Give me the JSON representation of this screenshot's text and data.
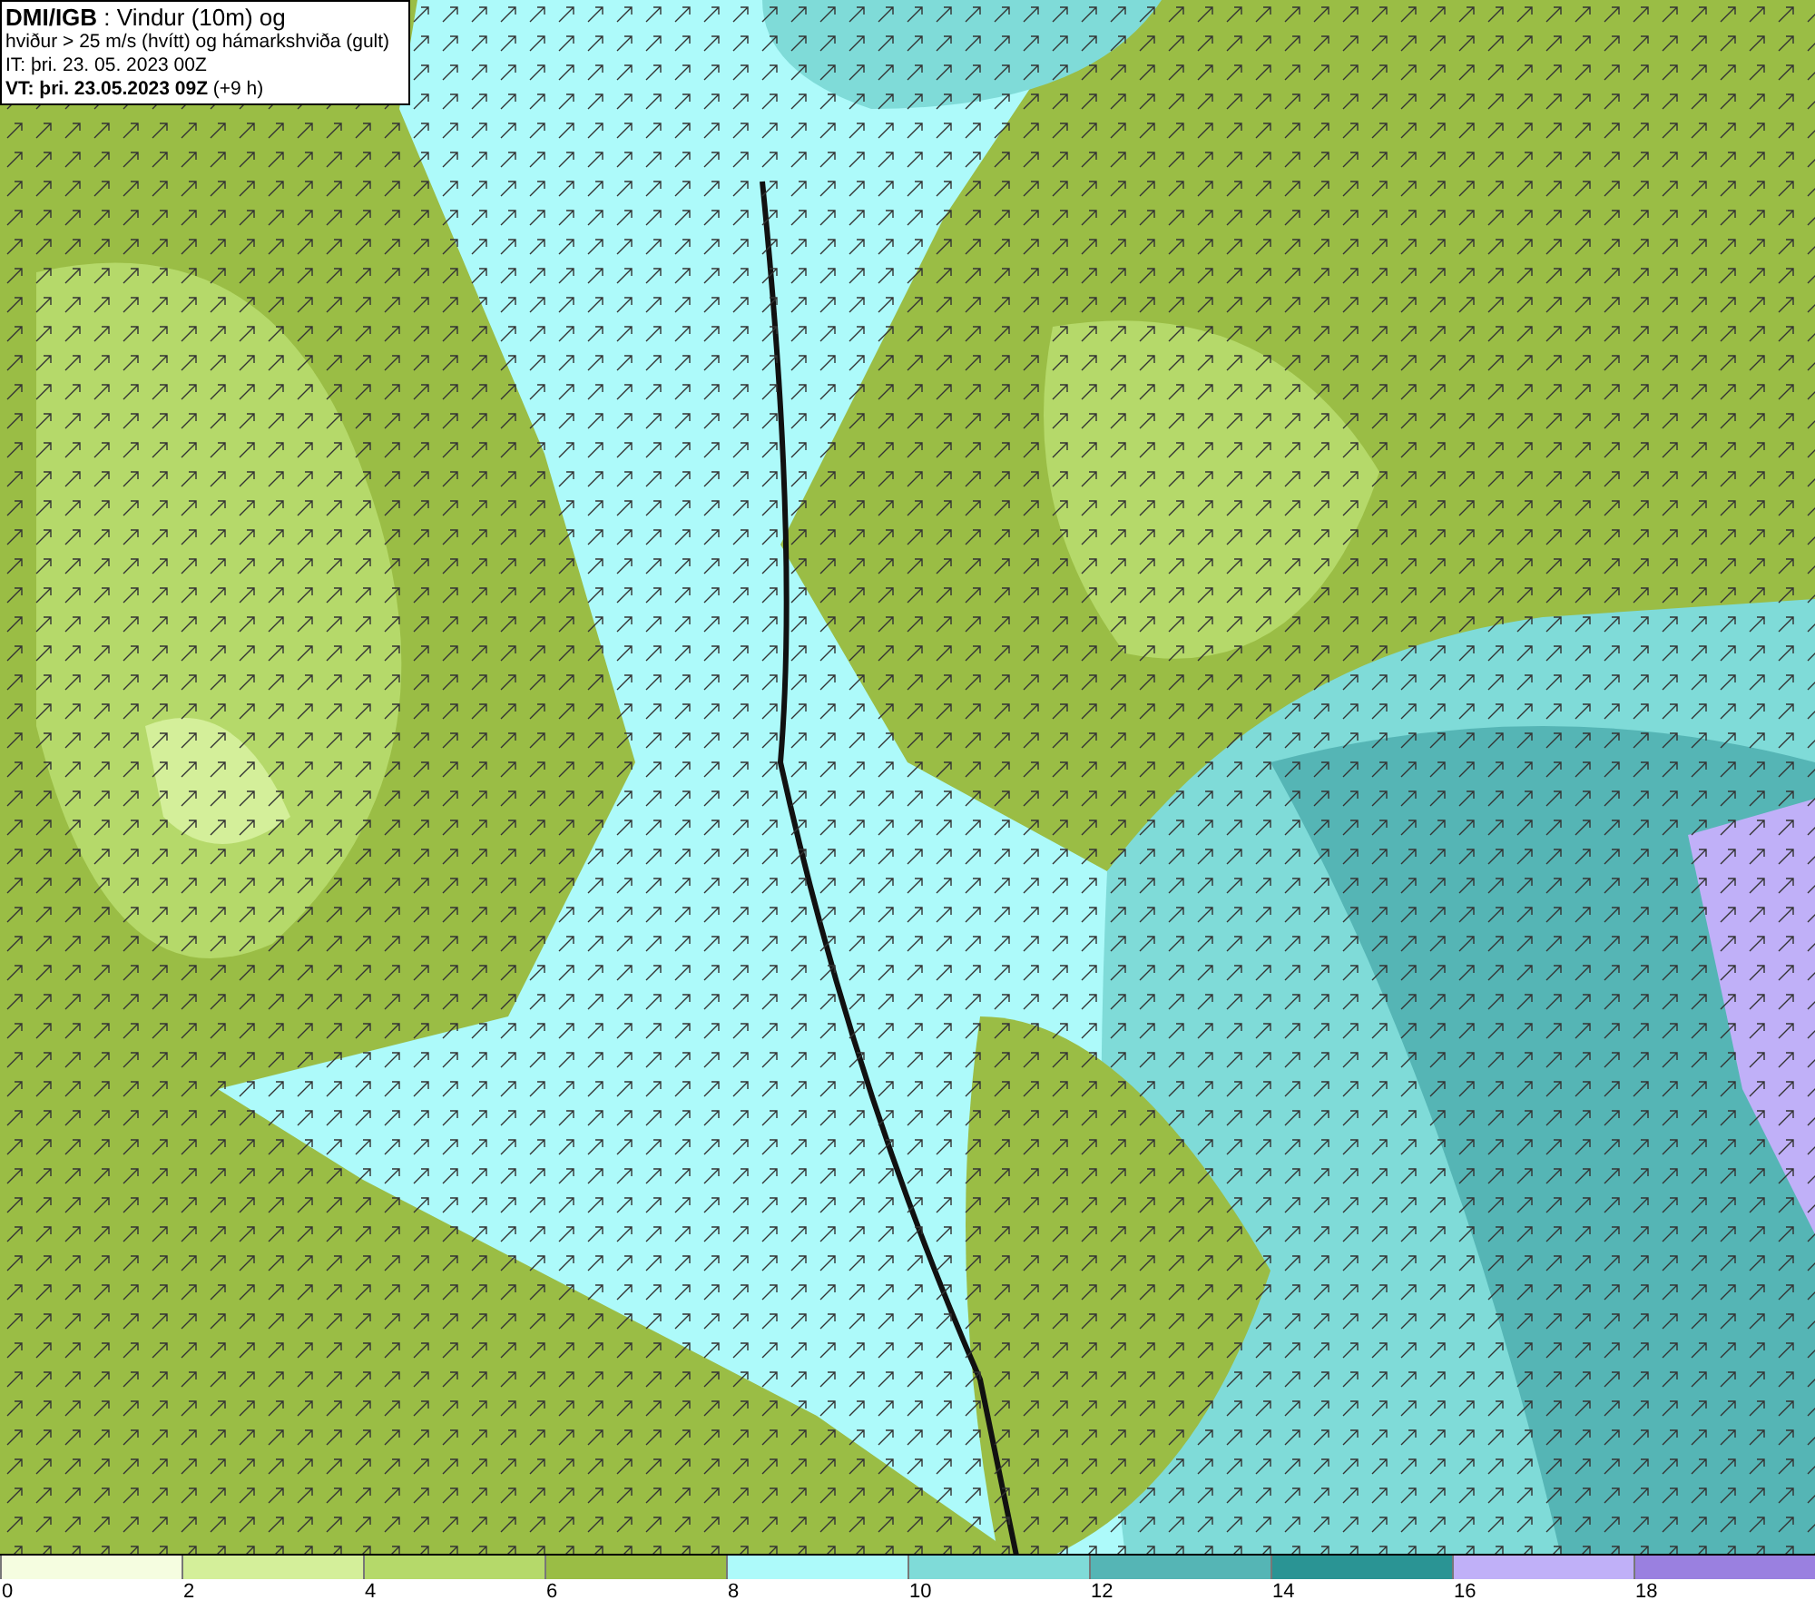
{
  "header": {
    "lines": [
      "**DMI/IGB** : Vindur (10m) og",
      "hviður > 25 m/s (hvítt) og hámarkshviða (gult)",
      "IT: þri. 23. 05. 2023 00Z",
      "**VT: þri. 23.05.2023 09Z** (+9 h)"
    ]
  },
  "legend": [
    {
      "label": "0",
      "color": "#f5fde0"
    },
    {
      "label": "2",
      "color": "#d4ef9a"
    },
    {
      "label": "4",
      "color": "#b5d96a"
    },
    {
      "label": "6",
      "color": "#9abd45"
    },
    {
      "label": "8",
      "color": "#adfafa"
    },
    {
      "label": "10",
      "color": "#7fdbd8"
    },
    {
      "label": "12",
      "color": "#55b5b5"
    },
    {
      "label": "14",
      "color": "#2a9494"
    },
    {
      "label": "16",
      "color": "#c0b0f8"
    },
    {
      "label": "18",
      "color": "#9a80e0"
    }
  ]
}
